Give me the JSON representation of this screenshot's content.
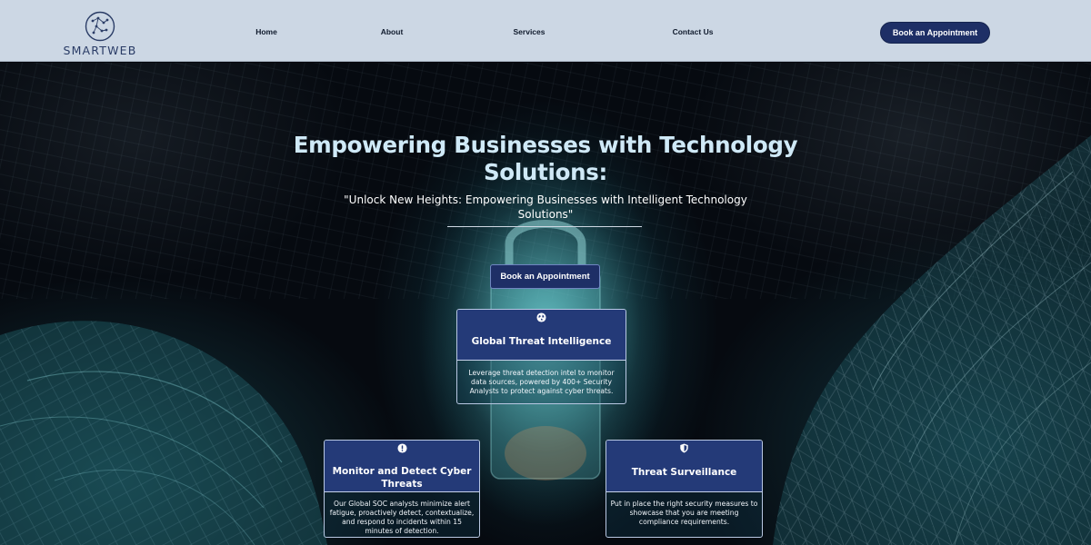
{
  "header": {
    "logo_text": "SMARTWEB",
    "nav": {
      "home": "Home",
      "about": "About",
      "services": "Services",
      "contact": "Contact Us"
    },
    "cta_label": "Book an Appointment"
  },
  "hero": {
    "title": "Empowering Businesses with Technology Solutions:",
    "subtitle": "\"Unlock New Heights: Empowering Businesses with Intelligent Technology Solutions\"",
    "cta_label": "Book an Appointment"
  },
  "cards": [
    {
      "icon": "globe-icon",
      "title": "Global Threat Intelligence",
      "text": "Leverage threat detection intel to monitor data sources, powered by 400+ Security Analysts to protect against cyber threats."
    },
    {
      "icon": "alert-icon",
      "title": "Monitor and Detect Cyber Threats",
      "text": "Our Global SOC analysts minimize alert fatigue, proactively detect, contextualize, and respond to incidents within 15 minutes of detection."
    },
    {
      "icon": "shield-icon",
      "title": "Threat Surveillance",
      "text": "Put in place the right security measures to showcase that you are meeting compliance requirements."
    }
  ],
  "colors": {
    "header_bg": "#ccd7e4",
    "brand_navy": "#1e2f66",
    "card_header": "#243a78",
    "hero_title": "#cfe9f7",
    "glow_teal": "#4ecdd6"
  }
}
